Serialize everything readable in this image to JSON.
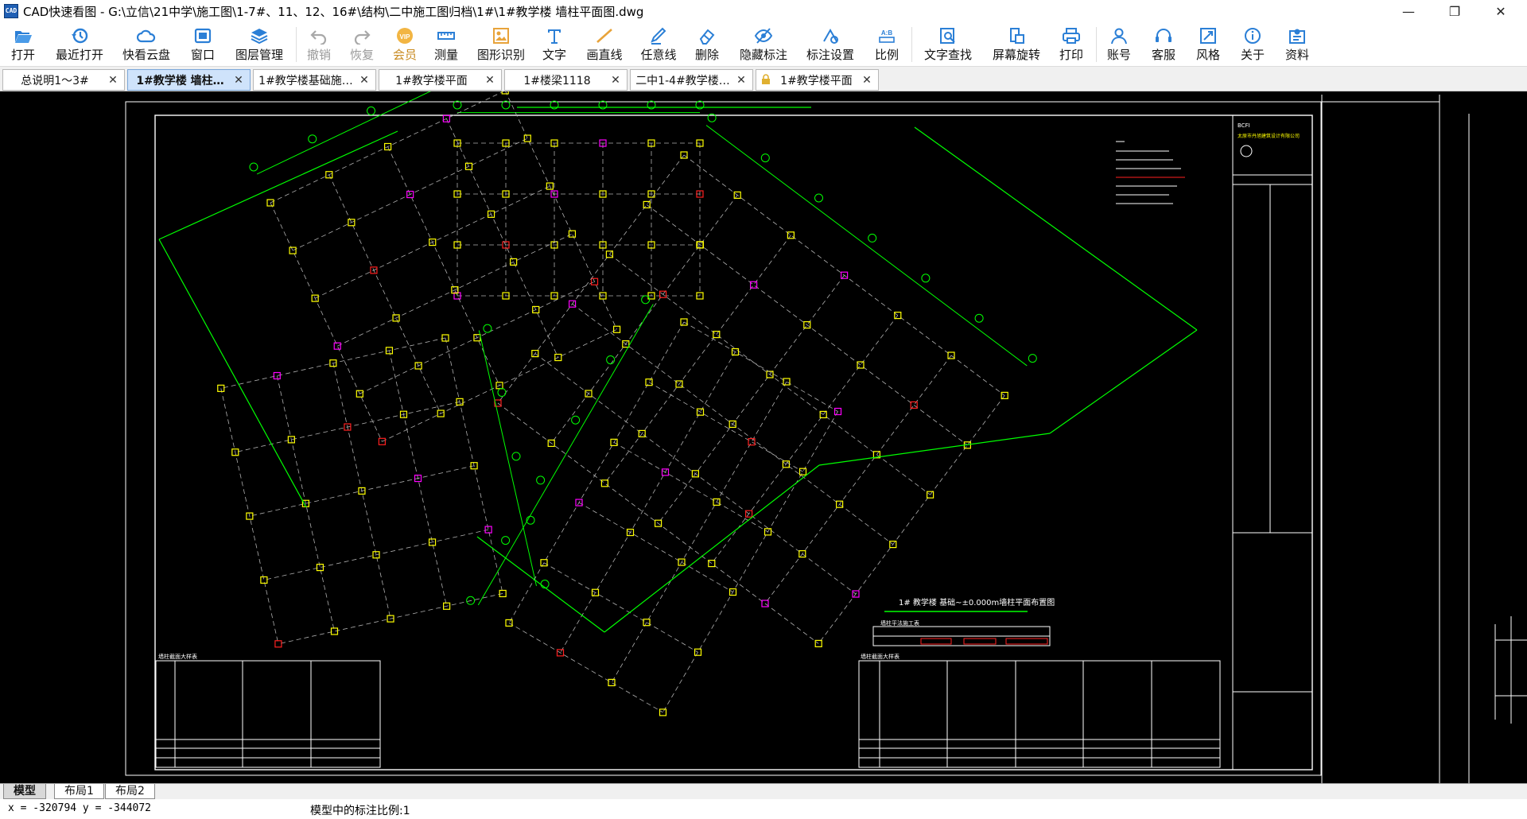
{
  "window": {
    "icon_text": "CAD",
    "title": "CAD快速看图 - G:\\立信\\21中学\\施工图\\1-7#、11、12、16#\\结构\\二中施工图归档\\1#\\1#教学楼 墙柱平面图.dwg",
    "minimize": "—",
    "maximize": "❐",
    "close": "✕"
  },
  "toolbar": {
    "open": "打开",
    "recent": "最近打开",
    "cloud": "快看云盘",
    "window": "窗口",
    "layers": "图层管理",
    "undo": "撤销",
    "redo": "恢复",
    "vip": "会员",
    "measure": "测量",
    "recognize": "图形识别",
    "text": "文字",
    "line": "画直线",
    "freeline": "任意线",
    "delete": "删除",
    "hide_annot": "隐藏标注",
    "annot_settings": "标注设置",
    "scale": "比例",
    "text_search": "文字查找",
    "rotate": "屏幕旋转",
    "print": "打印",
    "account": "账号",
    "service": "客服",
    "style": "风格",
    "about": "关于",
    "resources": "资料",
    "vip_badge": "VIP",
    "scale_icon_text": "A:B",
    "icon_color": "#2b7fd6",
    "icon_color_orange": "#e8a33a"
  },
  "tabs": [
    {
      "label": "总说明1～3#",
      "close": "✕",
      "active": false,
      "locked": false
    },
    {
      "label": "1#教学楼  墙柱…",
      "close": "✕",
      "active": true,
      "locked": false
    },
    {
      "label": "1#教学楼基础施…",
      "close": "✕",
      "active": false,
      "locked": false
    },
    {
      "label": "1#教学楼平面",
      "close": "✕",
      "active": false,
      "locked": false
    },
    {
      "label": "1#楼梁1118",
      "close": "✕",
      "active": false,
      "locked": false
    },
    {
      "label": "二中1-4#教学楼…",
      "close": "✕",
      "active": false,
      "locked": false
    },
    {
      "label": "1#教学楼平面",
      "close": "✕",
      "active": false,
      "locked": true
    }
  ],
  "drawing": {
    "plan_title": "1# 教学楼  基础~±0.000m墙柱平面布置图",
    "table_title": "墙柱平法施工表",
    "detail_title_left": "墙柱截面大样表",
    "detail_title_right": "墙柱截面大样表",
    "titleblock_company": "太原市丹旭建筑设计有限公司",
    "colors": {
      "background": "#000000",
      "frame": "#ffffff",
      "axis": "#00ff00",
      "dash": "#b0b0b0",
      "column": "#ffff00",
      "wall": "#ff00ff",
      "red": "#ff2020",
      "blue": "#3030ff"
    }
  },
  "layouts": [
    {
      "label": "模型",
      "active": true
    },
    {
      "label": "布局1",
      "active": false
    },
    {
      "label": "布局2",
      "active": false
    }
  ],
  "status": {
    "coords": "x = -320794  y = -344072",
    "scale_text": "模型中的标注比例:1"
  }
}
